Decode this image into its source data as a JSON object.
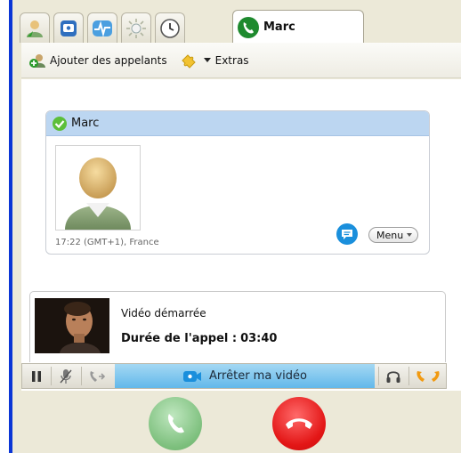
{
  "tabs": {
    "active_label": "Marc",
    "icons": [
      "contact-icon",
      "dialpad-icon",
      "pulse-icon",
      "sun-icon",
      "clock-icon",
      "phone-icon"
    ]
  },
  "toolbar": {
    "add_callers_label": "Ajouter des appelants",
    "extras_label": "Extras"
  },
  "contact": {
    "name": "Marc",
    "meta": "17:22 (GMT+1), France",
    "menu_label": "Menu"
  },
  "call": {
    "status": "Vidéo démarrée",
    "duration_label": "Durée de l'appel :",
    "duration_value": "03:40"
  },
  "controls": {
    "stop_video_label": "Arrêter ma vidéo"
  },
  "colors": {
    "accent_blue": "#1a8fdc",
    "header_blue": "#bcd6f1",
    "answer_green": "#7cbf7c",
    "hangup_red": "#e31616",
    "window_border_blue": "#0b36d6"
  }
}
